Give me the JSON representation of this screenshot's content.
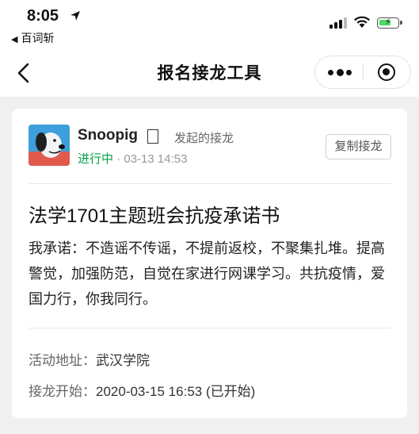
{
  "status_bar": {
    "time": "8:05",
    "back_app": "百词斩"
  },
  "navbar": {
    "title": "报名接龙工具"
  },
  "post": {
    "username": "Snoopig",
    "initiated_label": "发起的接龙",
    "status": "进行中",
    "separator": "·",
    "datetime": "03-13 14:53",
    "copy_button": "复制接龙",
    "title": "法学1701主题班会抗疫承诺书",
    "body": "我承诺：不造谣不传谣，不提前返校，不聚集扎堆。提高警觉，加强防范，自觉在家进行网课学习。共抗疫情，爱国力行，你我同行。",
    "location_label": "活动地址：",
    "location_value": "武汉学院",
    "start_label": "接龙开始：",
    "start_value": "2020-03-15 16:53 (已开始)"
  },
  "colors": {
    "status_active": "#07a14a",
    "battery": "#4cd964",
    "background": "#f0f0f0"
  }
}
